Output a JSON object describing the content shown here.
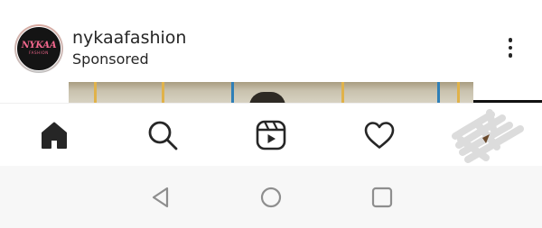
{
  "post": {
    "account_name": "nykaafashion",
    "sponsored_label": "Sponsored",
    "avatar_logo": {
      "main": "NYKAA",
      "sub": "FASHION",
      "color": "#f0678c",
      "background": "#141414"
    },
    "more_icon": "more-vertical-icon"
  },
  "bottom_nav": {
    "items": [
      {
        "icon": "home-icon",
        "active": true
      },
      {
        "icon": "search-icon",
        "active": false
      },
      {
        "icon": "reels-icon",
        "active": false
      },
      {
        "icon": "heart-icon",
        "active": false
      },
      {
        "icon": "profile-icon",
        "active": false
      }
    ]
  },
  "system_nav": {
    "items": [
      {
        "icon": "back-icon"
      },
      {
        "icon": "home-circle-icon"
      },
      {
        "icon": "recents-square-icon"
      }
    ]
  },
  "colors": {
    "text": "#262626",
    "system_icon": "#8e8e8e",
    "system_bar": "#f7f7f7"
  }
}
